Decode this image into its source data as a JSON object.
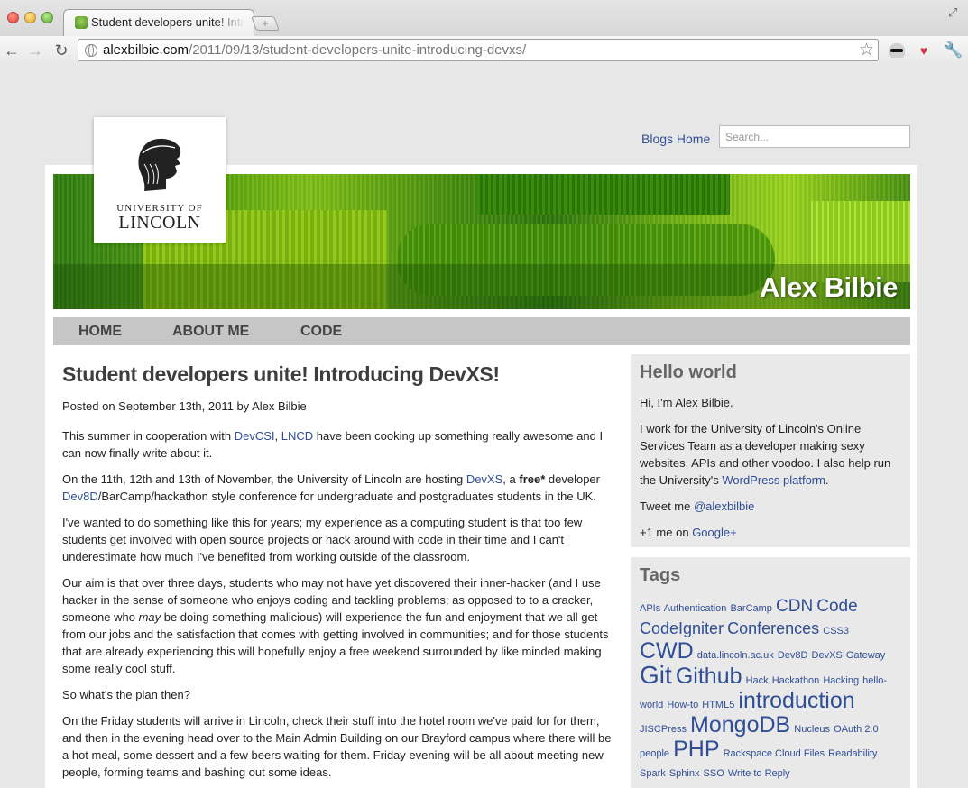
{
  "browser": {
    "tab_title": "Student developers unite! Introducing DevXS!",
    "new_tab_icon": "+",
    "url_domain": "alexbilbie.com",
    "url_path": "/2011/09/13/student-developers-unite-introducing-devxs/"
  },
  "header": {
    "blogs_home": "Blogs Home",
    "search_placeholder": "Search...",
    "logo_line1": "UNIVERSITY OF",
    "logo_line2": "LINCOLN",
    "banner_name": "Alex Bilbie"
  },
  "nav": {
    "home": "HOME",
    "about": "ABOUT ME",
    "code": "CODE"
  },
  "article": {
    "title": "Student developers unite! Introducing DevXS!",
    "meta": "Posted on September 13th, 2011 by Alex Bilbie",
    "p1_a": "This summer in cooperation with ",
    "p1_link1": "DevCSI",
    "p1_b": ", ",
    "p1_link2": "LNCD",
    "p1_c": " have been cooking up something really awesome and I can now finally write about it.",
    "p2_a": "On the 11th, 12th and 13th of November, the University of Lincoln are hosting ",
    "p2_link1": "DevXS",
    "p2_b": ", a ",
    "p2_bold": "free*",
    "p2_c": " developer ",
    "p2_link2": "Dev8D",
    "p2_d": "/BarCamp/hackathon style conference for undergraduate and postgraduates students in the UK.",
    "p3": "I've wanted to do something like this for years; my experience as a computing student is that too few students get involved with open source projects or hack around with code in their time and I can't underestimate how much I've benefited from working outside of the classroom.",
    "p4_a": "Our aim is that over three days, students who may not have yet discovered their inner-hacker (and I use hacker in the sense of someone who enjoys coding and tackling problems; as opposed to to a cracker, someone who ",
    "p4_em": "may",
    "p4_b": " be doing something malicious) will experience the fun and enjoyment that we all get from our jobs and the satisfaction that comes with getting involved in communities; and for those students that are already experiencing this will hopefully enjoy a free weekend surrounded by like minded making some really cool stuff.",
    "p5": "So what's the plan then?",
    "p6": "On the Friday students will arrive in Lincoln, check their stuff into the hotel room we've paid for for them, and then in the evening head over to the Main Admin Building on our Brayford campus where there will be a hot meal, some dessert and a few beers waiting for them. Friday evening will be all about meeting new people, forming teams and bashing out some ideas."
  },
  "sidebar": {
    "hello_title": "Hello world",
    "hello_p1": "Hi, I'm Alex Bilbie.",
    "hello_p2_a": "I work for the University of Lincoln's Online Services Team as a developer making sexy websites, APIs and other voodoo. I also help run the University's ",
    "hello_p2_link": "WordPress platform",
    "hello_p2_b": ".",
    "tweet_a": "Tweet me ",
    "tweet_link": "@alexbilbie",
    "plus_a": "+1 me on ",
    "plus_link": "Google+",
    "tags_title": "Tags",
    "tags": [
      {
        "label": "APIs",
        "size": 11
      },
      {
        "label": "Authentication",
        "size": 11
      },
      {
        "label": "BarCamp",
        "size": 11
      },
      {
        "label": "CDN",
        "size": 19
      },
      {
        "label": "Code",
        "size": 19
      },
      {
        "label": "CodeIgniter",
        "size": 18
      },
      {
        "label": "Conferences",
        "size": 18
      },
      {
        "label": "CSS3",
        "size": 11
      },
      {
        "label": "CWD",
        "size": 25
      },
      {
        "label": "data.lincoln.ac.uk",
        "size": 11
      },
      {
        "label": "Dev8D",
        "size": 11
      },
      {
        "label": "DevXS",
        "size": 11
      },
      {
        "label": "Gateway",
        "size": 11
      },
      {
        "label": "Git",
        "size": 28
      },
      {
        "label": "Github",
        "size": 25
      },
      {
        "label": "Hack",
        "size": 11
      },
      {
        "label": "Hackathon",
        "size": 11
      },
      {
        "label": "Hacking",
        "size": 11
      },
      {
        "label": "hello-world",
        "size": 11
      },
      {
        "label": "How-to",
        "size": 11
      },
      {
        "label": "HTML5",
        "size": 11
      },
      {
        "label": "introduction",
        "size": 25
      },
      {
        "label": "JISCPress",
        "size": 11
      },
      {
        "label": "MongoDB",
        "size": 25
      },
      {
        "label": "Nucleus",
        "size": 11
      },
      {
        "label": "OAuth 2.0",
        "size": 11
      },
      {
        "label": "people",
        "size": 11
      },
      {
        "label": "PHP",
        "size": 25
      },
      {
        "label": "Rackspace Cloud Files",
        "size": 11
      },
      {
        "label": "Readability",
        "size": 11
      },
      {
        "label": "Spark",
        "size": 11
      },
      {
        "label": "Sphinx",
        "size": 11
      },
      {
        "label": "SSO",
        "size": 11
      },
      {
        "label": "Write to Reply",
        "size": 11
      }
    ]
  },
  "colors": {
    "link": "#2f4e96",
    "nav_bg": "#c6c6c6",
    "sidebar_bg": "#e9e9e9"
  }
}
